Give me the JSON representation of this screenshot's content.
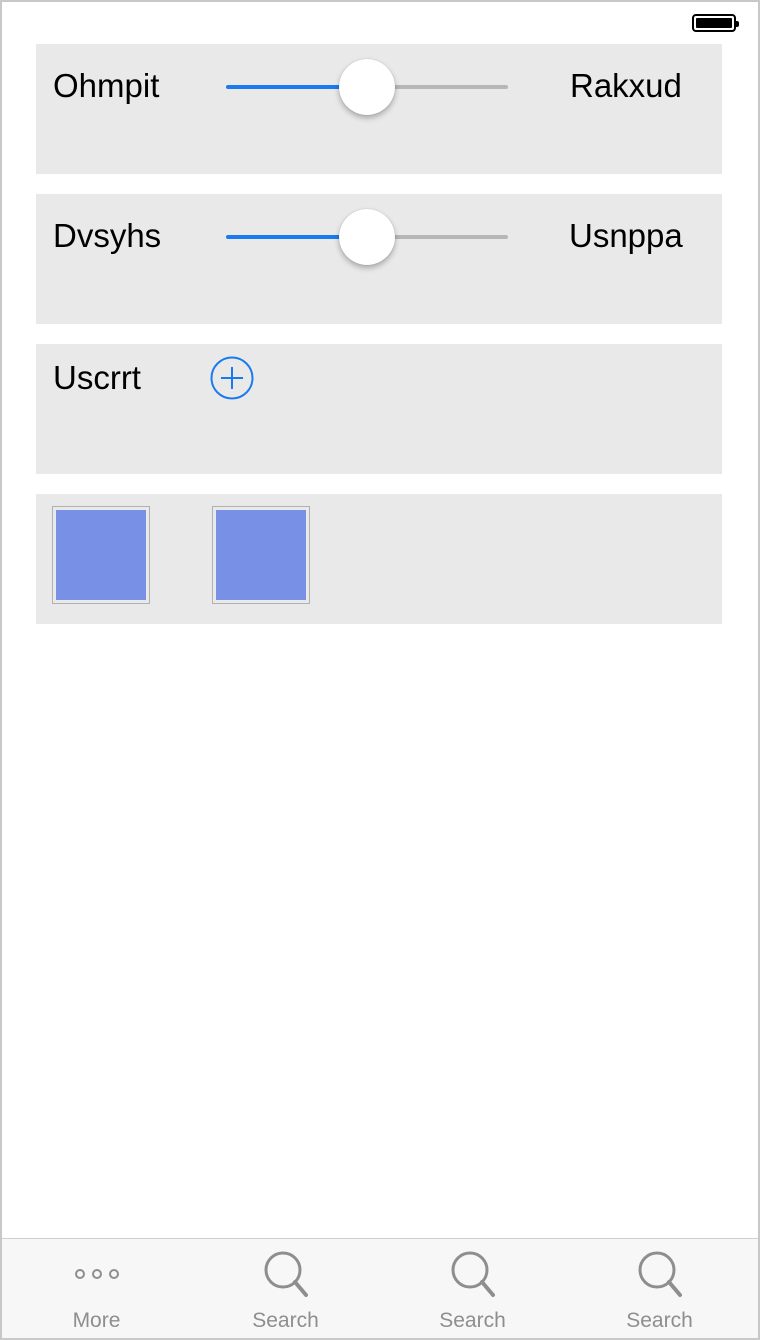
{
  "status_bar": {
    "battery_icon": "battery-full-icon"
  },
  "rows": [
    {
      "type": "slider",
      "label": "Ohmpit",
      "value_label": "Rakxud",
      "value": 0.5
    },
    {
      "type": "slider",
      "label": "Dvsyhs",
      "value_label": "Usnppa",
      "value": 0.5
    },
    {
      "type": "add",
      "label": "Uscrrt",
      "icon": "plus-circle-icon"
    },
    {
      "type": "swatches",
      "colors": [
        "#7890e6",
        "#7890e6"
      ]
    }
  ],
  "colors": {
    "accent": "#1a7bf0",
    "panel": "#e9e9e9",
    "swatch": "#7890e6"
  },
  "tabbar": {
    "tabs": [
      {
        "label": "More",
        "icon": "more-dots-icon"
      },
      {
        "label": "Search",
        "icon": "search-icon"
      },
      {
        "label": "Search",
        "icon": "search-icon"
      },
      {
        "label": "Search",
        "icon": "search-icon"
      }
    ]
  }
}
